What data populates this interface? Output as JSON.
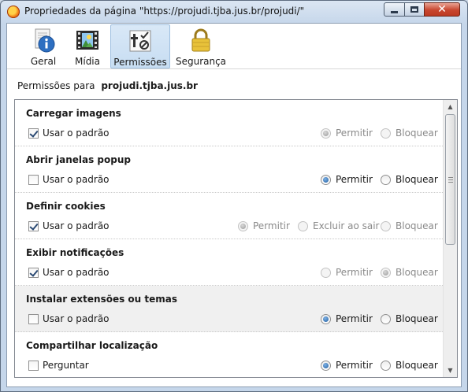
{
  "window": {
    "title": "Propriedades da página \"https://projudi.tjba.jus.br/projudi/\"",
    "close_glyph": "✕"
  },
  "tabs": [
    {
      "label": "Geral",
      "icon": "info-icon",
      "selected": false
    },
    {
      "label": "Mídia",
      "icon": "media-icon",
      "selected": false
    },
    {
      "label": "Permissões",
      "icon": "permissions-icon",
      "selected": true
    },
    {
      "label": "Segurança",
      "icon": "padlock-icon",
      "selected": false
    }
  ],
  "permissions_for": {
    "label": "Permissões para",
    "host": "projudi.tjba.jus.br"
  },
  "groups": [
    {
      "title": "Carregar imagens",
      "checkbox_label": "Usar o padrão",
      "checked": true,
      "options": [
        {
          "label": "Permitir",
          "selected": true,
          "disabled": true
        },
        {
          "label": "Bloquear",
          "selected": false,
          "disabled": true
        }
      ]
    },
    {
      "title": "Abrir janelas popup",
      "checkbox_label": "Usar o padrão",
      "checked": false,
      "options": [
        {
          "label": "Permitir",
          "selected": true,
          "disabled": false
        },
        {
          "label": "Bloquear",
          "selected": false,
          "disabled": false
        }
      ]
    },
    {
      "title": "Definir cookies",
      "checkbox_label": "Usar o padrão",
      "checked": true,
      "options": [
        {
          "label": "Permitir",
          "selected": true,
          "disabled": true
        },
        {
          "label": "Excluir ao sair",
          "selected": false,
          "disabled": true
        },
        {
          "label": "Bloquear",
          "selected": false,
          "disabled": true
        }
      ]
    },
    {
      "title": "Exibir notificações",
      "checkbox_label": "Usar o padrão",
      "checked": true,
      "options": [
        {
          "label": "Permitir",
          "selected": false,
          "disabled": true
        },
        {
          "label": "Bloquear",
          "selected": true,
          "disabled": true
        }
      ]
    },
    {
      "title": "Instalar extensões ou temas",
      "checkbox_label": "Usar o padrão",
      "checked": false,
      "hover": true,
      "options": [
        {
          "label": "Permitir",
          "selected": true,
          "disabled": false
        },
        {
          "label": "Bloquear",
          "selected": false,
          "disabled": false
        }
      ]
    },
    {
      "title": "Compartilhar localização",
      "checkbox_label": "Perguntar",
      "checked": false,
      "options": [
        {
          "label": "Permitir",
          "selected": true,
          "disabled": false
        },
        {
          "label": "Bloquear",
          "selected": false,
          "disabled": false
        }
      ]
    }
  ],
  "scrollbar": {
    "up_glyph": "▲",
    "down_glyph": "▼"
  },
  "colors": {
    "selected_tab": "#c7ddf2",
    "radio_on": "#1f5d9f",
    "close_button": "#c8462e"
  }
}
